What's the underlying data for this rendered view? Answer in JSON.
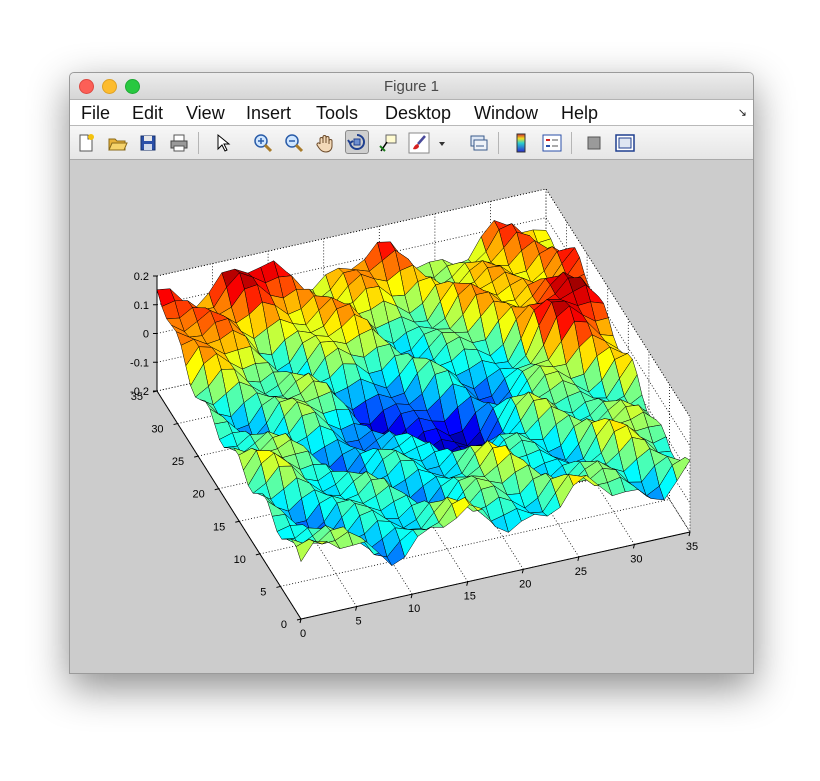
{
  "window": {
    "title": "Figure 1"
  },
  "menu": [
    "File",
    "Edit",
    "View",
    "Insert",
    "Tools",
    "Desktop",
    "Window",
    "Help"
  ],
  "menu_overflow_icon": "dock-arrow-icon",
  "toolbar": {
    "buttons": [
      "new-figure-icon",
      "open-file-icon",
      "save-icon",
      "print-icon",
      "edit-plot-arrow-icon",
      "zoom-in-icon",
      "zoom-out-icon",
      "pan-hand-icon",
      "rotate-3d-icon",
      "data-cursor-icon",
      "brush-icon",
      "brush-dropdown-icon",
      "link-plot-icon",
      "colorbar-icon",
      "legend-icon",
      "hide-plot-tools-icon",
      "show-plot-tools-icon"
    ],
    "pressed": "rotate-3d-icon"
  },
  "chart_data": {
    "type": "surface",
    "colormap": "jet",
    "grid": true,
    "box": true,
    "x_ticks": [
      "0",
      "5",
      "10",
      "15",
      "20",
      "25",
      "30",
      "35"
    ],
    "y_ticks": [
      "0",
      "5",
      "10",
      "15",
      "20",
      "25",
      "30",
      "35"
    ],
    "z_ticks": [
      "-0.2",
      "-0.1",
      "0",
      "0.1",
      "0.2"
    ],
    "xlim": [
      0,
      35
    ],
    "ylim": [
      0,
      35
    ],
    "zlim": [
      -0.2,
      0.2
    ],
    "grid_points": [
      31,
      31
    ]
  }
}
